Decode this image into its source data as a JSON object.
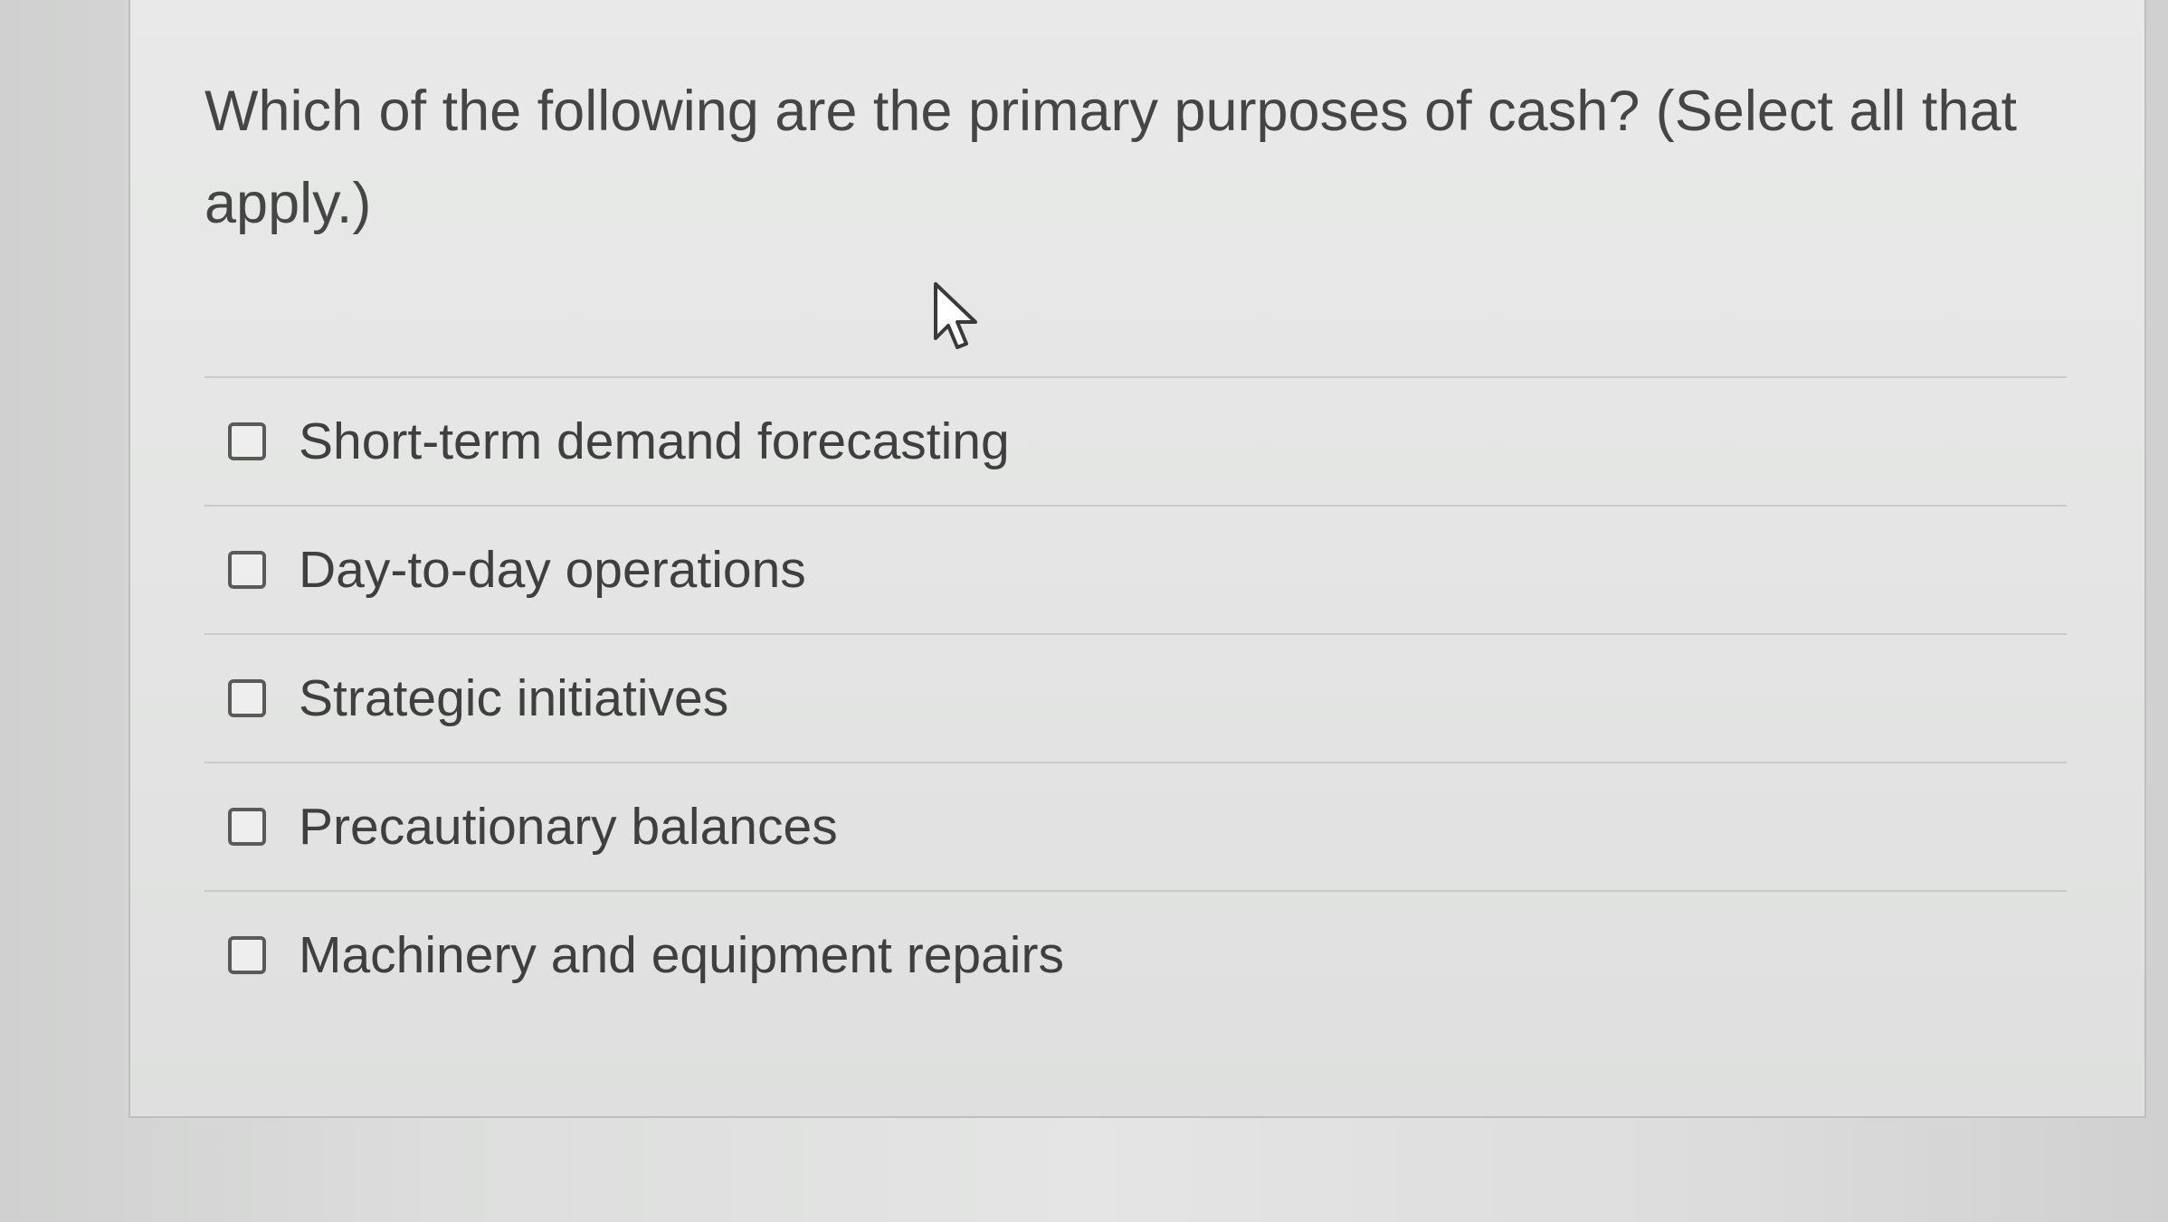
{
  "question": {
    "text": "Which of the following are the primary purposes of cash? (Select all that apply.)"
  },
  "cursor_icon": "arrow-pointer-icon",
  "options": [
    {
      "label": "Short-term demand forecasting",
      "checked": false
    },
    {
      "label": "Day-to-day operations",
      "checked": false
    },
    {
      "label": "Strategic initiatives",
      "checked": false
    },
    {
      "label": "Precautionary balances",
      "checked": false
    },
    {
      "label": "Machinery and equipment repairs",
      "checked": false
    }
  ],
  "colors": {
    "text": "#454545",
    "checkbox_border": "#5a5a5a",
    "card_background": "#e5e6e5",
    "divider": "#c9cac9"
  }
}
